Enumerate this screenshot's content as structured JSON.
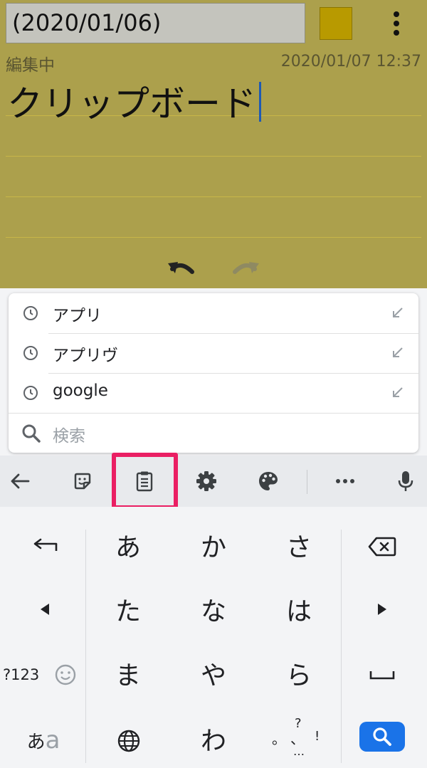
{
  "note": {
    "title": "(2020/01/06)",
    "status": "編集中",
    "timestamp": "2020/01/07 12:37",
    "body_text": "クリップボード",
    "colors": {
      "background": "#aca04c",
      "swatch": "#b89a00",
      "rule": "#c8b648"
    }
  },
  "suggestions": [
    {
      "text": "アプリ"
    },
    {
      "text": "アプリヴ"
    },
    {
      "text": "google"
    }
  ],
  "search": {
    "placeholder": "検索"
  },
  "toolbar": {
    "icons": [
      "back-arrow-icon",
      "sticker-icon",
      "clipboard-icon",
      "gear-icon",
      "palette-icon",
      "more-horizontal-icon",
      "microphone-icon"
    ],
    "highlight_color": "#ea1f63"
  },
  "keyboard": {
    "rows": [
      [
        "あ",
        "か",
        "さ"
      ],
      [
        "た",
        "な",
        "は"
      ],
      [
        "ま",
        "や",
        "ら"
      ],
      [
        "わ"
      ]
    ],
    "numeric_label": "?123",
    "kana_toggle_a": "あ",
    "kana_toggle_b": "a",
    "punct_top": "?",
    "punct_left": "。",
    "punct_mid": "、",
    "punct_right": "!",
    "punct_bottom": "…",
    "search_key_color": "#1a73e8"
  }
}
